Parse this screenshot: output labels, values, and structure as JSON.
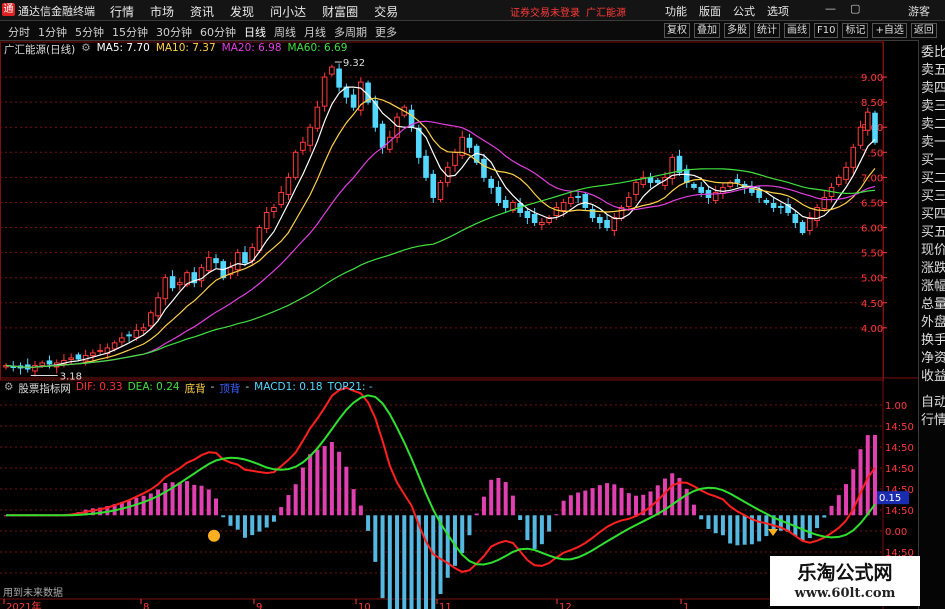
{
  "app": {
    "title": "通达信金融终端"
  },
  "menu": [
    "行情",
    "市场",
    "资讯",
    "发现",
    "问小达",
    "财富圈",
    "交易"
  ],
  "notices": [
    "证券交易未登录",
    "广汇能源"
  ],
  "right_menu": [
    "功能",
    "版面",
    "公式",
    "选项"
  ],
  "account": {
    "guest": "游客"
  },
  "periods": [
    "分时",
    "1分钟",
    "5分钟",
    "15分钟",
    "30分钟",
    "60分钟",
    "日线",
    "周线",
    "月线",
    "多周期",
    "更多"
  ],
  "active_period": "日线",
  "tools": [
    "复权",
    "叠加",
    "多股",
    "统计",
    "画线",
    "F10",
    "标记",
    "+自选",
    "返回"
  ],
  "stock": {
    "name": "广汇能源(日线)",
    "high_label": "9.32",
    "low_label": "3.18"
  },
  "ma": [
    {
      "label": "MA5: 7.70",
      "color": "#ffffff"
    },
    {
      "label": "MA10: 7.37",
      "color": "#ffd24a"
    },
    {
      "label": "MA20: 6.98",
      "color": "#e040e0"
    },
    {
      "label": "MA60: 6.69",
      "color": "#40e040"
    }
  ],
  "price_axis": [
    "9.00",
    "8.50",
    "8.00",
    "7.50",
    "7.00",
    "6.50",
    "6.00",
    "5.50",
    "5.00",
    "4.50",
    "4.00"
  ],
  "indicator": {
    "name": "股票指标网",
    "dif": "DIF: 0.33",
    "dea": "DEA: 0.24",
    "sig1": "底背",
    "sig2": "- ",
    "sig3": "顶背",
    "sig4": "-",
    "macd": "MACD1: 0.18",
    "top": "TOP21: -",
    "axis": [
      "1.00",
      "14:50",
      "14:50",
      "14:50",
      "14:50",
      "14:50",
      "0.00",
      "14:50",
      "14:50"
    ],
    "current": "0.15"
  },
  "dates": [
    "2021年",
    "8",
    "9",
    "10",
    "11",
    "12",
    "1"
  ],
  "side_panel": [
    "委比",
    "卖五",
    "卖四",
    "卖三",
    "卖二",
    "卖一",
    "买一",
    "买二",
    "买三",
    "买四",
    "买五",
    "现价",
    "涨跌",
    "涨幅",
    "总量",
    "外盘",
    "换手",
    "净资",
    "收益",
    "自动",
    "行情"
  ],
  "footer_note": "用到未来数据",
  "watermark": {
    "cn": "乐淘公式网",
    "url": "www.60lt.com"
  },
  "colors": {
    "up": "#ff3a3a",
    "down": "#54d8ff",
    "grid": "#7a1010"
  },
  "chart_data": [
    {
      "type": "candlestick",
      "title": "广汇能源(日线)",
      "ylim": [
        3.0,
        9.5
      ],
      "series_close": [
        3.25,
        3.22,
        3.2,
        3.18,
        3.25,
        3.3,
        3.28,
        3.3,
        3.35,
        3.4,
        3.38,
        3.45,
        3.5,
        3.55,
        3.6,
        3.7,
        3.8,
        3.85,
        3.95,
        4.0,
        4.3,
        4.6,
        5.0,
        4.8,
        4.9,
        5.1,
        4.9,
        5.2,
        5.4,
        5.3,
        5.0,
        5.2,
        5.5,
        5.3,
        5.6,
        6.0,
        6.3,
        6.4,
        6.7,
        7.0,
        7.5,
        7.7,
        8.0,
        8.4,
        9.0,
        9.2,
        8.8,
        8.6,
        8.4,
        8.9,
        8.5,
        8.0,
        7.6,
        7.8,
        8.2,
        8.4,
        8.0,
        7.4,
        7.0,
        6.6,
        6.9,
        7.2,
        7.5,
        7.8,
        7.6,
        7.3,
        7.0,
        6.8,
        6.5,
        6.4,
        6.5,
        6.3,
        6.2,
        6.1,
        6.1,
        6.2,
        6.4,
        6.5,
        6.6,
        6.6,
        6.4,
        6.2,
        6.1,
        6.0,
        6.2,
        6.4,
        6.6,
        6.9,
        7.0,
        6.9,
        6.9,
        7.0,
        7.4,
        7.1,
        6.9,
        6.8,
        6.7,
        6.6,
        6.7,
        6.8,
        6.9,
        6.9,
        6.8,
        6.7,
        6.6,
        6.5,
        6.4,
        6.4,
        6.3,
        6.1,
        5.9,
        6.2,
        6.4,
        6.6,
        6.8,
        7.0,
        7.2,
        7.6,
        8.0,
        8.3,
        7.7
      ]
    },
    {
      "type": "line+bar",
      "title": "股票指标网",
      "series": [
        {
          "name": "DIF",
          "color": "#ff2020"
        },
        {
          "name": "DEA",
          "color": "#30e030"
        }
      ],
      "ylim": [
        -0.7,
        1.1
      ]
    }
  ]
}
